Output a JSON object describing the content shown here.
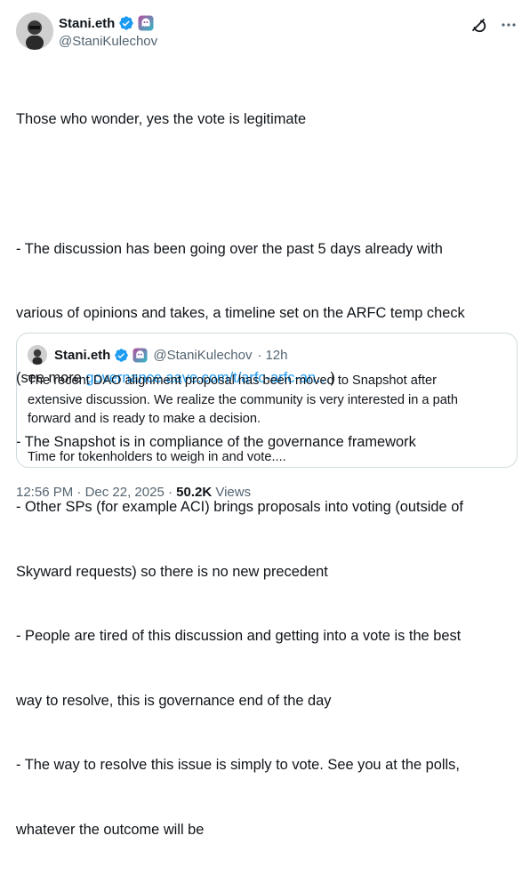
{
  "author": {
    "display_name": "Stani.eth",
    "handle": "@StaniKulechov",
    "verified_color": "#1d9bf0",
    "affiliate_icon": "ghost-logo-icon"
  },
  "post": {
    "lines": [
      "Those who wonder, yes the vote is legitimate",
      "",
      "- The discussion has been going over the past 5 days already with",
      "various of opinions and takes, a timeline set on the ARFC temp check",
      "(see more ",
      "- The Snapshot is in compliance of the governance framework",
      "- Other SPs (for example ACI) brings proposals into voting (outside of",
      "Skyward requests) so there is no new precedent",
      "- People are tired of this discussion and getting into a vote is the best",
      "way to resolve, this is governance end of the day",
      "- The way to resolve this issue is simply to vote. See you at the polls,",
      "whatever the outcome will be"
    ],
    "link_text": "governance.aave.com/t/arfc-arfc-an…",
    "link_suffix": ")"
  },
  "quote": {
    "display_name": "Stani.eth",
    "handle": "@StaniKulechov",
    "separator": "·",
    "time": "12h",
    "lines": [
      "The recent DAO alignment proposal has been moved to Snapshot after",
      "extensive discussion. We realize the community is very interested in a path",
      "forward and is ready to make a decision.",
      "",
      "Time for tokenholders to weigh in and vote...."
    ]
  },
  "footer": {
    "time": "12:56 PM",
    "separator": "·",
    "date": "Dec 22, 2025",
    "views_count": "50.2K",
    "views_label": "Views"
  }
}
